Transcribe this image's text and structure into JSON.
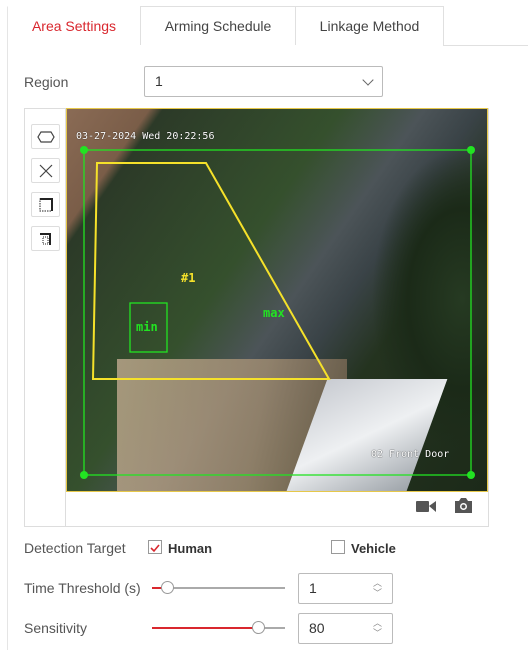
{
  "tabs": [
    {
      "label": "Area Settings",
      "active": true
    },
    {
      "label": "Arming Schedule"
    },
    {
      "label": "Linkage Method"
    }
  ],
  "region": {
    "label": "Region",
    "value": "1"
  },
  "toolbar": [
    "draw-polygon-icon",
    "clear-icon",
    "max-size-icon",
    "min-size-icon"
  ],
  "video": {
    "timestamp": "03-27-2024 Wed 20:22:56",
    "camera_name": "02 Front Door",
    "region_label": "#1",
    "max_label": "max",
    "min_label": "min",
    "region_color": "#f5e12a",
    "size_color": "#22e322"
  },
  "video_controls": [
    "record-icon",
    "snapshot-icon"
  ],
  "detection_target": {
    "label": "Detection Target",
    "options": [
      {
        "label": "Human",
        "checked": true
      },
      {
        "label": "Vehicle",
        "checked": false
      }
    ]
  },
  "time_threshold": {
    "label": "Time Threshold (s)",
    "value": "1",
    "slider_fraction": 0.05
  },
  "sensitivity": {
    "label": "Sensitivity",
    "value": "80",
    "slider_fraction": 0.8
  },
  "accent": "#d9272e"
}
